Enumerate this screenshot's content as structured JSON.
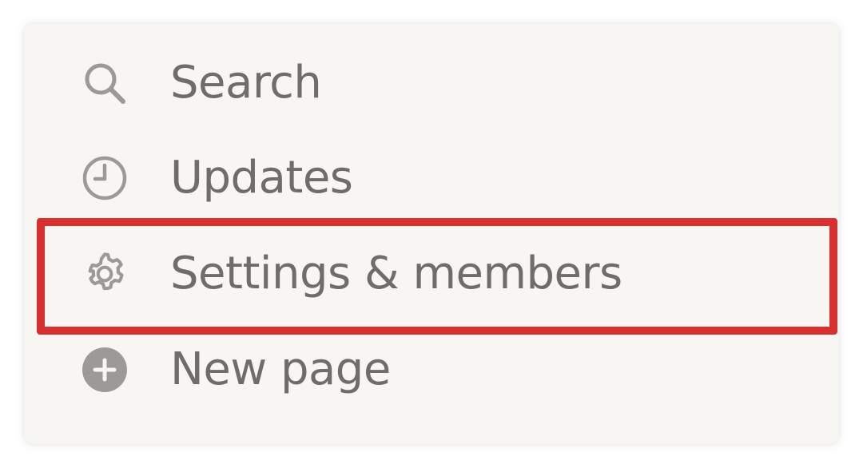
{
  "menu": {
    "items": [
      {
        "id": "search",
        "label": "Search",
        "icon": "search-icon"
      },
      {
        "id": "updates",
        "label": "Updates",
        "icon": "clock-icon"
      },
      {
        "id": "settings",
        "label": "Settings & members",
        "icon": "gear-icon"
      },
      {
        "id": "new-page",
        "label": "New page",
        "icon": "plus-circle-icon"
      }
    ]
  },
  "colors": {
    "panel_background": "#f7f6f3",
    "text": "#6e6d69",
    "icon": "#9b9a97",
    "highlight_border": "#d8302f"
  },
  "highlight": {
    "target": "settings"
  }
}
